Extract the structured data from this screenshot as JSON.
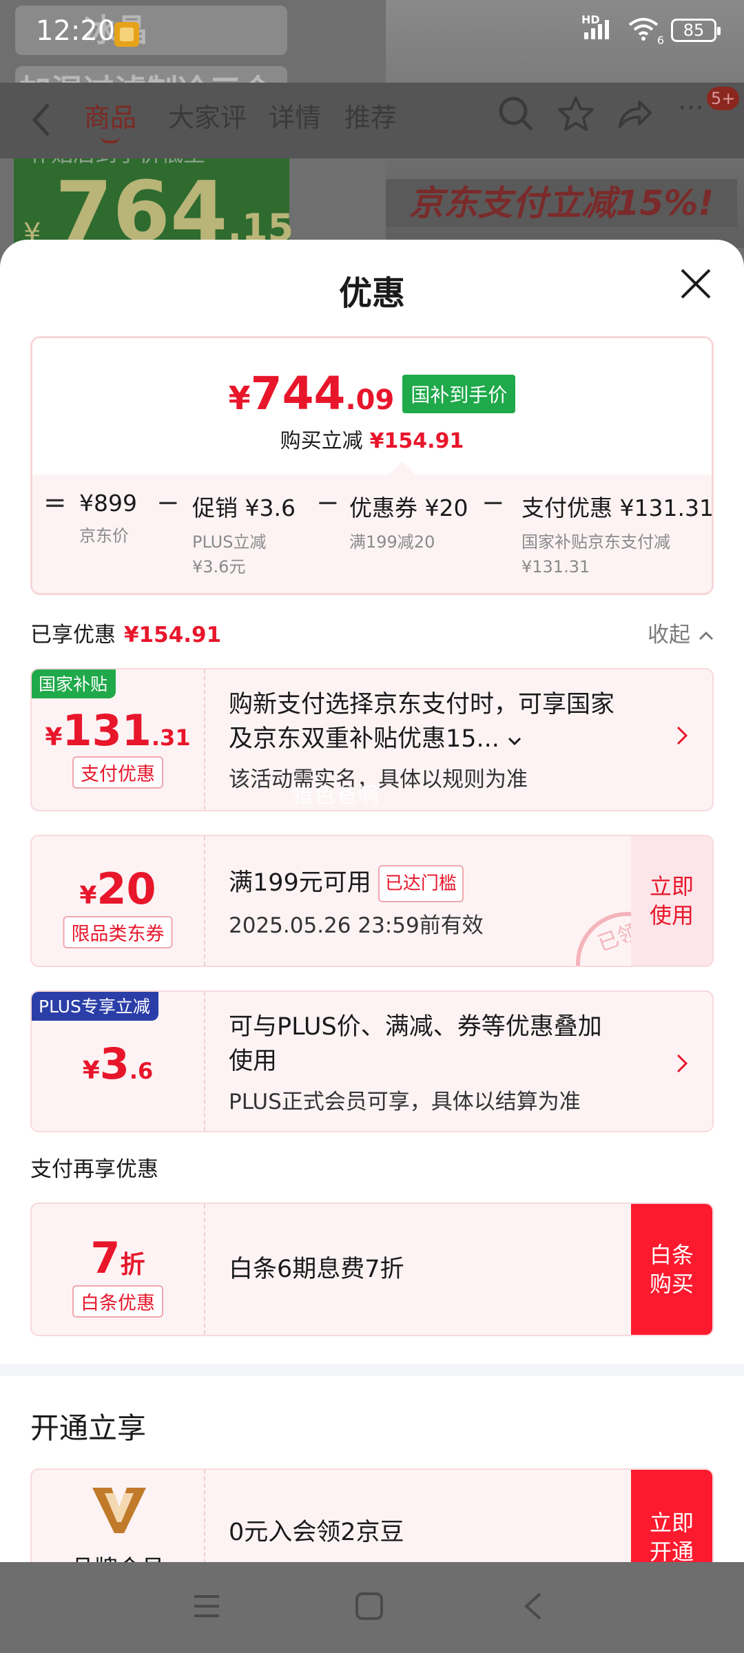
{
  "status_bar": {
    "time": "12:20",
    "network": "HD",
    "wifi_badge": "6",
    "battery": "85"
  },
  "background": {
    "product_title_line1": "冰晶",
    "product_title_line2": "加湿过滤制冷三合一",
    "price_label": "补贴后到手价低至",
    "price_currency": "¥",
    "price_int": "764",
    "price_dec": ".15",
    "banner": "京东支付立减15%!"
  },
  "top_nav": {
    "tabs": [
      {
        "label": "商品"
      },
      {
        "label": "大家评"
      },
      {
        "label": "详情"
      },
      {
        "label": "推荐"
      }
    ],
    "message_badge": "5+"
  },
  "sheet": {
    "title": "优惠",
    "summary": {
      "currency": "¥",
      "price_int": "744",
      "price_dec": ".09",
      "tag": "国补到手价",
      "reduce_label": "购买立减",
      "reduce_amount": "¥154.91",
      "equals": "=",
      "items": [
        {
          "main": "¥899",
          "sub": "京东价"
        },
        {
          "main": "促销 ¥3.6",
          "sub": "PLUS立减",
          "sub2": "¥3.6元"
        },
        {
          "main": "优惠券 ¥20",
          "sub": "满199减20"
        },
        {
          "main": "支付优惠 ¥131.31",
          "sub": "国家补贴京东支付减",
          "sub2": "¥131.31"
        }
      ],
      "minus": "−"
    },
    "enjoyed_label": "已享优惠",
    "enjoyed_amount": "¥154.91",
    "collapse_label": "收起",
    "cards": [
      {
        "corner_tag": "国家补贴",
        "corner_color": "#1fa94a",
        "currency": "¥",
        "int": "131",
        "dec": ".31",
        "pill": "支付优惠",
        "line1": "购新支付选择京东支付时，可享国家",
        "line2": "及京东双重补贴优惠15...",
        "line3": "该活动需实名，具体以规则为准"
      },
      {
        "currency": "¥",
        "int": "20",
        "pill": "限品类东券",
        "line1": "满199元可用",
        "tag": "已达门槛",
        "line2": "2025.05.26 23:59前有效",
        "cta": "立即使用",
        "cta_line1": "立即",
        "cta_line2": "使用",
        "stamp": "已领"
      },
      {
        "corner_tag": "PLUS专享立减",
        "corner_color": "#2b3ea8",
        "currency": "¥",
        "int": "3",
        "dec": ".6",
        "line1": "可与PLUS价、满减、券等优惠叠加",
        "line2": "使用",
        "line3": "PLUS正式会员可享，具体以结算为准"
      }
    ],
    "pay_section_title": "支付再享优惠",
    "baitiao": {
      "int": "7",
      "unit": "折",
      "pill": "白条优惠",
      "text": "白条6期息费7折",
      "cta_line1": "白条",
      "cta_line2": "购买"
    },
    "open_section_title": "开通立享",
    "member": {
      "logo_label": "品牌会员",
      "text": "0元入会领2京豆",
      "cta_line1": "立即",
      "cta_line2": "开通"
    }
  },
  "watermark": "猎色爸啊",
  "colors": {
    "accent": "#e8162b",
    "green": "#1fa94a",
    "plus_blue": "#2b3ea8"
  }
}
